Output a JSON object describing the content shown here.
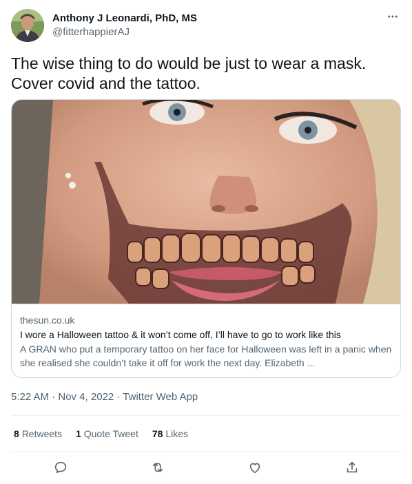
{
  "tweet": {
    "author_name": "Anthony J Leonardi, PhD, MS",
    "author_handle": "@fitterhappierAJ",
    "text": "The wise thing to do would be just to wear a mask. Cover covid and the tattoo.",
    "timestamp": "5:22 AM · Nov 4, 2022 · Twitter Web App"
  },
  "card": {
    "domain": "thesun.co.uk",
    "title": "I wore a Halloween tattoo & it won’t come off, I’ll have to go to work like this",
    "description": "A GRAN who put a temporary tattoo on her face for Halloween was left in a panic when she realised she couldn’t take it off for work the next day. Elizabeth ..."
  },
  "stats": {
    "retweets_count": "8",
    "retweets_label": "Retweets",
    "quotes_count": "1",
    "quotes_label": "Quote Tweet",
    "likes_count": "78",
    "likes_label": "Likes"
  },
  "icons": {
    "more": "more-options-icon",
    "reply": "reply-icon",
    "retweet": "retweet-icon",
    "like": "like-icon",
    "share": "share-icon"
  },
  "colors": {
    "text_primary": "#0f1419",
    "text_secondary": "#536471",
    "border": "#cfd9de",
    "divider": "#eff3f4"
  }
}
